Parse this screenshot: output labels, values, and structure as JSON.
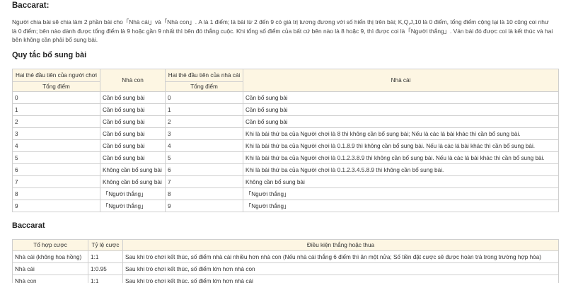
{
  "title": "Baccarat:",
  "intro": "Người chia bài sẽ chia làm 2 phần bài cho「Nhà cái」và「Nhà con」. A là 1 điểm; lá bài từ 2 đến 9 có giá trị tương đương với số hiển thị trên bài; K,Q,J,10 là 0 điểm, tổng điểm cộng lại là 10 cũng coi như là 0 điểm; bên nào dành được tổng điểm là 9 hoặc gần 9 nhất thì bên đó thắng cuộc. Khi tổng số điểm của bất cứ bên nào là 8 hoặc 9, thì được coi là「Người thắng」. Ván bài đó được coi là kết thúc và hai bên không cần phải bổ sung bài.",
  "rules": {
    "heading": "Quy tắc bổ sung bài",
    "headers": {
      "player_first_two": "Hai thẻ đầu tiên của người chơi",
      "player_total": "Tổng điểm",
      "player_col": "Nhà con",
      "banker_first_two": "Hai thẻ đầu tiên của nhà cái",
      "banker_total": "Tổng điểm",
      "banker_col": "Nhà cái"
    },
    "rows": [
      {
        "p": "0",
        "pa": "Cần bổ sung bài",
        "b": "0",
        "ba": "Cần bổ sung bài"
      },
      {
        "p": "1",
        "pa": "Cần bổ sung bài",
        "b": "1",
        "ba": "Cần bổ sung bài"
      },
      {
        "p": "2",
        "pa": "Cần bổ sung bài",
        "b": "2",
        "ba": "Cần bổ sung bài"
      },
      {
        "p": "3",
        "pa": "Cần bổ sung bài",
        "b": "3",
        "ba": "Khi là bài thứ ba của Người chơi là 8 thì không cần bổ sung bài; Nếu là các lá bài khác thì cần bổ sung bài."
      },
      {
        "p": "4",
        "pa": "Cần bổ sung bài",
        "b": "4",
        "ba": "Khi là bài thứ ba của Người chơi là 0.1.8.9 thì không cần bổ sung bài. Nếu là các lá bài khác thì cần bổ sung bài."
      },
      {
        "p": "5",
        "pa": "Cần bổ sung bài",
        "b": "5",
        "ba": "Khi là bài thứ ba của Người chơi là 0.1.2.3.8.9 thì không cần bổ sung bài. Nếu là các lá bài khác thì cần bổ sung bài."
      },
      {
        "p": "6",
        "pa": "Không cần bổ sung bài",
        "b": "6",
        "ba": "Khi là bài thứ ba của Người chơi là 0.1.2.3.4.5.8.9 thì không cần bổ sung bài."
      },
      {
        "p": "7",
        "pa": "Không cần bổ sung bài",
        "b": "7",
        "ba": "Không cần bổ sung bài"
      },
      {
        "p": "8",
        "pa": "「Người thắng」",
        "b": "8",
        "ba": "「Người thắng」"
      },
      {
        "p": "9",
        "pa": "「Người thắng」",
        "b": "9",
        "ba": "「Người thắng」"
      }
    ]
  },
  "baccarat": {
    "heading": "Baccarat",
    "headers": {
      "bet": "Tổ hợp cược",
      "odds": "Tỷ lệ cược",
      "condition": "Điều kiện thắng hoặc thua"
    },
    "rows": [
      {
        "bet": "Nhà cái (không hoa hồng)",
        "odds": "1:1",
        "condition": "Sau khi trò chơi kết thúc, số điểm nhà cái nhiều hơn nhà con (Nếu nhà cái thắng 6 điểm thì ăn một nửa; Số tiền đặt cược sẽ được hoàn trả trong trường hợp hòa)"
      },
      {
        "bet": "Nhà cái",
        "odds": "1:0.95",
        "condition": "Sau khi trò chơi kết thúc, số điểm lớn hơn nhà con"
      },
      {
        "bet": "Nhà con",
        "odds": "1:1",
        "condition": "Sau khi trò chơi kết thúc, số điểm lớn hơn nhà cái"
      }
    ]
  }
}
